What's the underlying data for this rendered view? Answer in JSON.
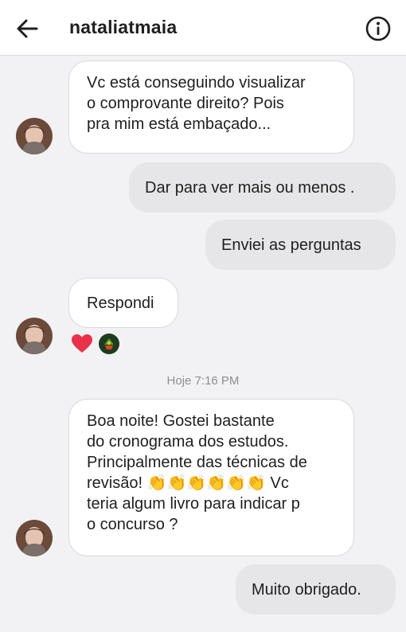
{
  "header": {
    "username": "nataliatmaia",
    "back_icon": "arrow-left-icon",
    "info_icon": "info-circle-icon"
  },
  "messages": [
    {
      "direction": "incoming",
      "lines": [
        "Vc está conseguindo visualizar",
        "o comprovante direito? Pois",
        "pra mim está embaçado..."
      ]
    },
    {
      "direction": "outgoing",
      "text": "Dar para ver mais ou menos ."
    },
    {
      "direction": "outgoing",
      "text": "Enviei as perguntas"
    },
    {
      "direction": "incoming",
      "text": "Respondi"
    },
    {
      "direction": "incoming",
      "lines": [
        "Boa noite! Gostei bastante",
        "do cronograma dos estudos.",
        "Principalmente das técnicas de",
        "revisão! 👏👏👏👏👏👏 Vc",
        "teria algum livro para indicar p",
        "o concurso ?"
      ]
    },
    {
      "direction": "outgoing",
      "text": "Muito obrigado."
    }
  ],
  "reactions": [
    "heart-icon",
    "sticker-icon"
  ],
  "timestamp": "Hoje 7:16 PM",
  "colors": {
    "incoming_bg": "#ffffff",
    "outgoing_bg": "#e6e6e8",
    "heart": "#e8324a"
  }
}
